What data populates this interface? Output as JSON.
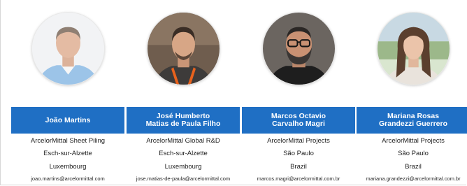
{
  "people": [
    {
      "name_lines": [
        "João Martins"
      ],
      "company": "ArcelorMittal Sheet Piling",
      "city": "Esch-sur-Alzette",
      "country": "Luxembourg",
      "email": "joao.martins@arcelormittal.com"
    },
    {
      "name_lines": [
        "José Humberto",
        "Matias de Paula Filho"
      ],
      "company": "ArcelorMittal Global R&D",
      "city": "Esch-sur-Alzette",
      "country": "Luxembourg",
      "email": "jose.matias-de-paula@arcelormittal.com"
    },
    {
      "name_lines": [
        "Marcos Octavio",
        "Carvalho Magri"
      ],
      "company": "ArcelorMittal Projects",
      "city": "São Paulo",
      "country": "Brazil",
      "email": "marcos.magri@arcelormittal.com.br"
    },
    {
      "name_lines": [
        "Mariana Rosas",
        "Grandezzi Guerrero"
      ],
      "company": "ArcelorMittal Projects",
      "city": "São Paulo",
      "country": "Brazil",
      "email": "mariana.grandezzi@arcelormittal.com.br"
    }
  ],
  "colors": {
    "name_bar": "#1f6fc4",
    "name_text": "#ffffff",
    "info_text": "#222222"
  }
}
